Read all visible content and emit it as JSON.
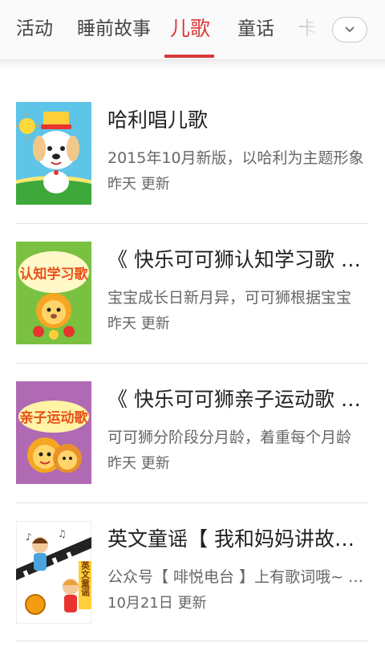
{
  "tabs": [
    {
      "label": "活动"
    },
    {
      "label": "睡前故事"
    },
    {
      "label": "儿歌"
    },
    {
      "label": "童话"
    },
    {
      "label": "卡"
    }
  ],
  "active_tab": "儿歌",
  "accent_color": "#d93a3a",
  "expand_icon": "chevron-down-icon",
  "items": [
    {
      "title": "哈利唱儿歌",
      "desc": "2015年10月新版，以哈利为主题形象",
      "time": "昨天 更新"
    },
    {
      "title": "《 快乐可可狮认知学习歌 》-分月龄",
      "desc": "宝宝成长日新月异，可可狮根据宝宝",
      "time": "昨天 更新"
    },
    {
      "title": "《 快乐可可狮亲子运动歌 》-分月龄",
      "desc": "可可狮分阶段分月龄，着重每个月龄",
      "time": "昨天 更新"
    },
    {
      "title": "英文童谣【 我和妈妈讲故事 】",
      "desc": "公众号【 啡悦电台 】上有歌词哦~ 快来",
      "time": "10月21日 更新"
    }
  ],
  "thumb_texts": {
    "item2": "认知学习歌",
    "item3": "亲子运动歌",
    "item4": "英文童谣"
  }
}
